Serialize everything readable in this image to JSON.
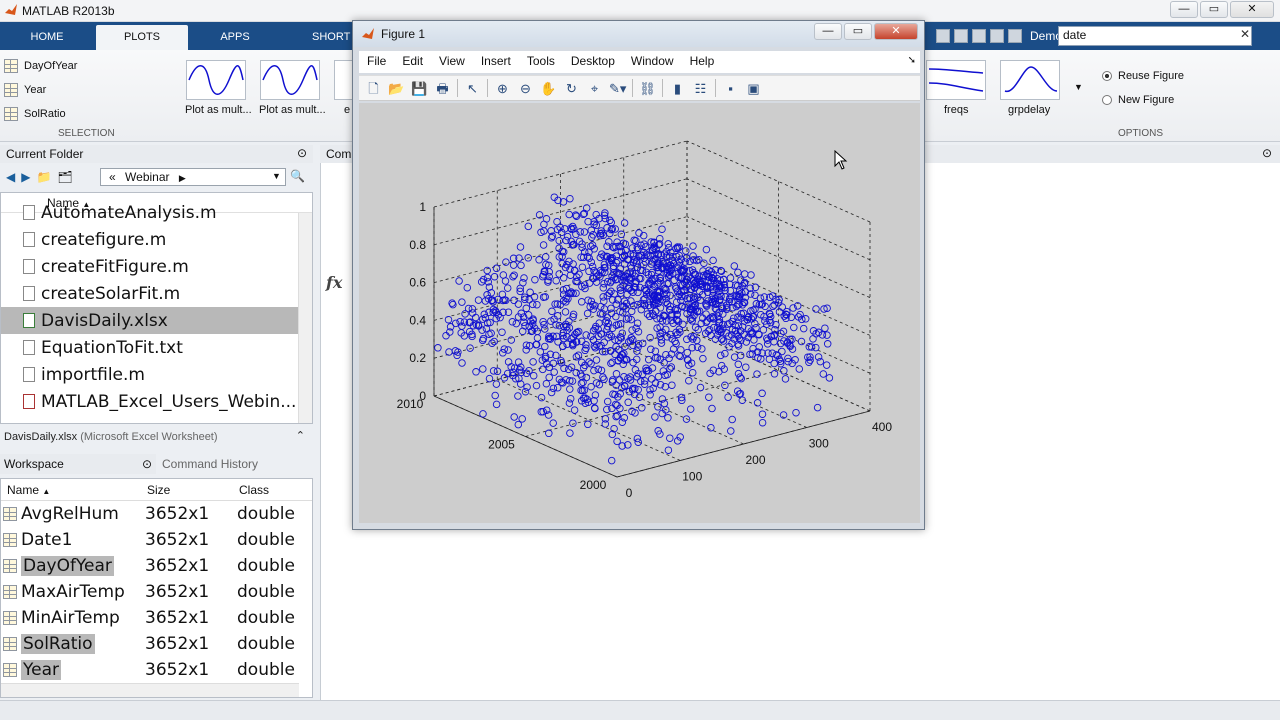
{
  "window": {
    "title": "MATLAB R2013b",
    "min": "—",
    "max": "▭",
    "close": "✕"
  },
  "tabs": [
    {
      "label": "HOME"
    },
    {
      "label": "PLOTS"
    },
    {
      "label": "APPS"
    },
    {
      "label": "SHORT"
    }
  ],
  "quick_access": {
    "demos_label": "Demos",
    "search_value": "date",
    "search_clear": "✕"
  },
  "ribbon": {
    "selection": {
      "items": [
        "DayOfYear",
        "Year",
        "SolRatio"
      ],
      "label": "SELECTION"
    },
    "plots": [
      {
        "label": "Plot as mult..."
      },
      {
        "label": "Plot as mult..."
      },
      {
        "label": "e"
      },
      {
        "label": "freqs"
      },
      {
        "label": "grpdelay"
      }
    ],
    "options": {
      "reuse": "Reuse Figure",
      "new": "New Figure",
      "label": "OPTIONS"
    }
  },
  "current_folder": {
    "title": "Current Folder",
    "path": "Webinar",
    "path_prefix": "«",
    "column_name": "Name",
    "files": [
      {
        "name": "AutomateAnalysis.m",
        "type": "m"
      },
      {
        "name": "createfigure.m",
        "type": "m"
      },
      {
        "name": "createFitFigure.m",
        "type": "m"
      },
      {
        "name": "createSolarFit.m",
        "type": "m"
      },
      {
        "name": "DavisDaily.xlsx",
        "type": "x"
      },
      {
        "name": "EquationToFit.txt",
        "type": "t"
      },
      {
        "name": "importfile.m",
        "type": "m"
      },
      {
        "name": "MATLAB_Excel_Users_Webin...",
        "type": "p"
      }
    ],
    "details_name": "DavisDaily.xlsx",
    "details_type": "(Microsoft Excel Worksheet)"
  },
  "workspace": {
    "tab_workspace": "Workspace",
    "tab_history": "Command History",
    "headers": {
      "name": "Name",
      "size": "Size",
      "class": "Class"
    },
    "variables": [
      {
        "name": "AvgRelHum",
        "size": "3652x1",
        "class": "double"
      },
      {
        "name": "Date1",
        "size": "3652x1",
        "class": "double"
      },
      {
        "name": "DayOfYear",
        "size": "3652x1",
        "class": "double"
      },
      {
        "name": "MaxAirTemp",
        "size": "3652x1",
        "class": "double"
      },
      {
        "name": "MinAirTemp",
        "size": "3652x1",
        "class": "double"
      },
      {
        "name": "SolRatio",
        "size": "3652x1",
        "class": "double"
      },
      {
        "name": "Year",
        "size": "3652x1",
        "class": "double"
      }
    ]
  },
  "command_window": {
    "title": "Com",
    "prompt": "fx"
  },
  "figure": {
    "title": "Figure 1",
    "menu": [
      "File",
      "Edit",
      "View",
      "Insert",
      "Tools",
      "Desktop",
      "Window",
      "Help"
    ],
    "toolbar_icons": [
      "new-figure-icon",
      "open-icon",
      "save-icon",
      "print-icon",
      "edit-plot-icon",
      "zoom-in-icon",
      "zoom-out-icon",
      "pan-icon",
      "rotate-icon",
      "data-cursor-icon",
      "brush-icon",
      "link-icon",
      "colorbar-icon",
      "legend-icon",
      "hide-tools-icon",
      "dock-icon"
    ]
  },
  "chart_data": {
    "type": "scatter",
    "title": "",
    "xlabel": "",
    "ylabel": "",
    "zlabel": "",
    "x_ticks": [
      "0",
      "100",
      "200",
      "300",
      "400"
    ],
    "y_ticks": [
      "2000",
      "2005",
      "2010"
    ],
    "z_ticks": [
      "0",
      "0.2",
      "0.4",
      "0.6",
      "0.8",
      "1"
    ],
    "xlim": [
      0,
      400
    ],
    "ylim": [
      2000,
      2010
    ],
    "zlim": [
      0,
      1
    ],
    "grid": true,
    "marker": "o",
    "color": "#1010d0",
    "point_count": 3652
  }
}
